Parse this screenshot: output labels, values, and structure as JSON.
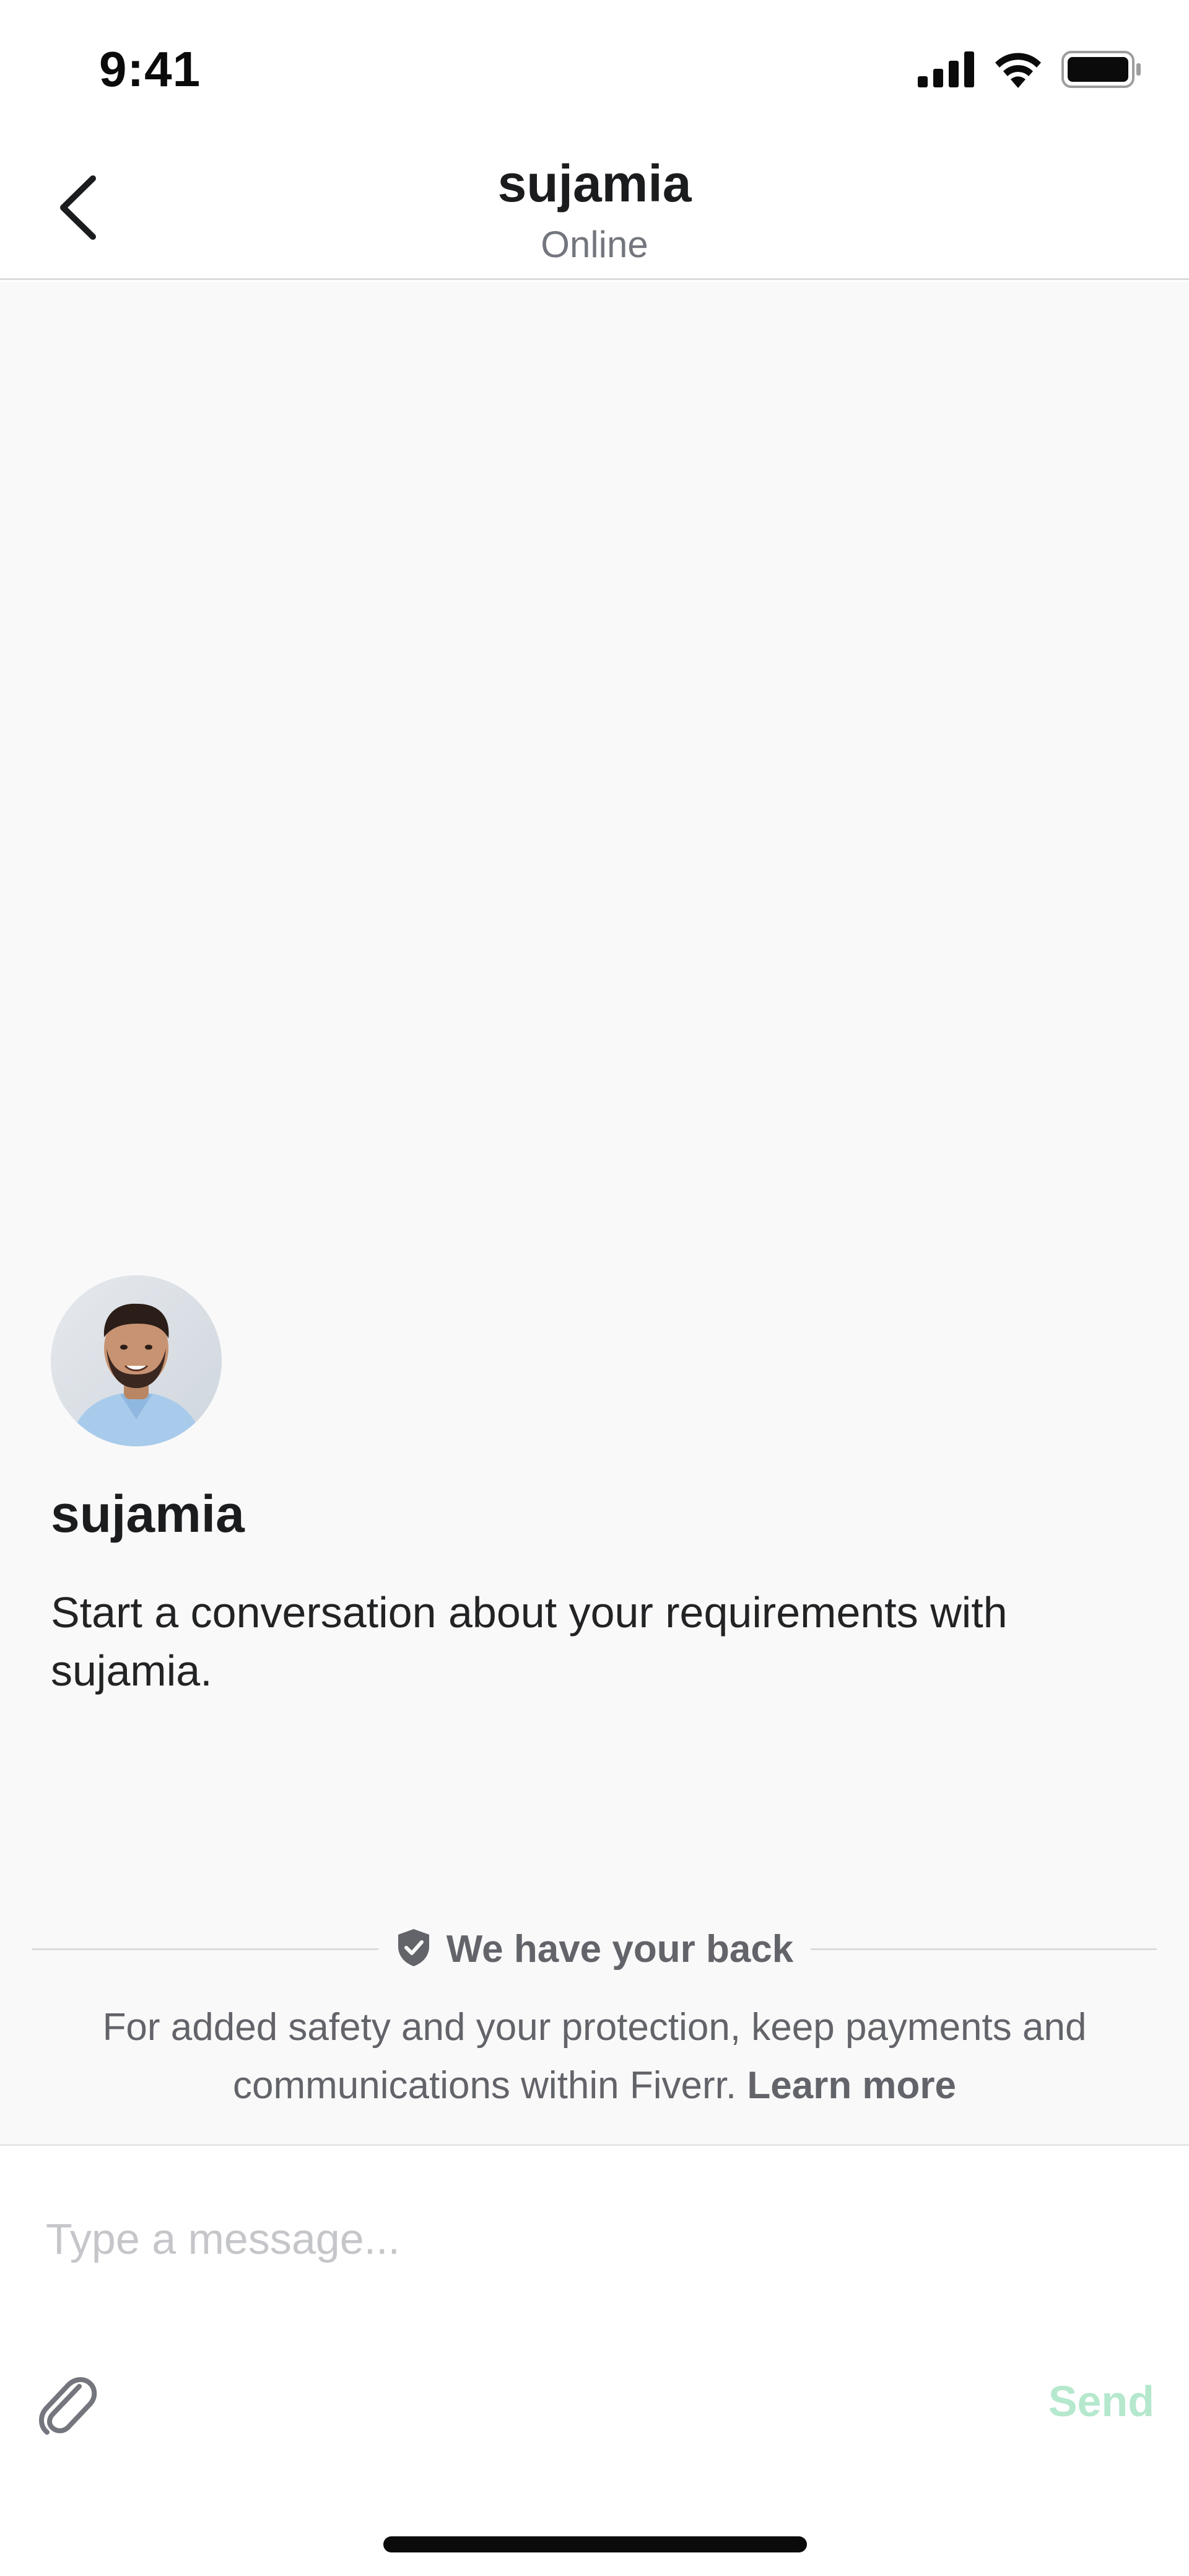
{
  "status_bar": {
    "time": "9:41"
  },
  "header": {
    "title": "sujamia",
    "subtitle": "Online",
    "back_icon": "chevron-left-icon"
  },
  "conversation": {
    "seller_name": "sujamia",
    "intro_text": "Start a conversation about your requirements with sujamia."
  },
  "safety": {
    "label": "We have your back",
    "icon": "shield-check-icon",
    "text": "For added safety and your protection, keep payments and communications within Fiverr.",
    "link": "Learn more"
  },
  "composer": {
    "placeholder": "Type a message...",
    "attach_icon": "paperclip-icon",
    "send_label": "Send"
  },
  "colors": {
    "send_disabled": "#b5e8cd",
    "muted_text": "#62646a",
    "background": "#f9f9f9"
  }
}
